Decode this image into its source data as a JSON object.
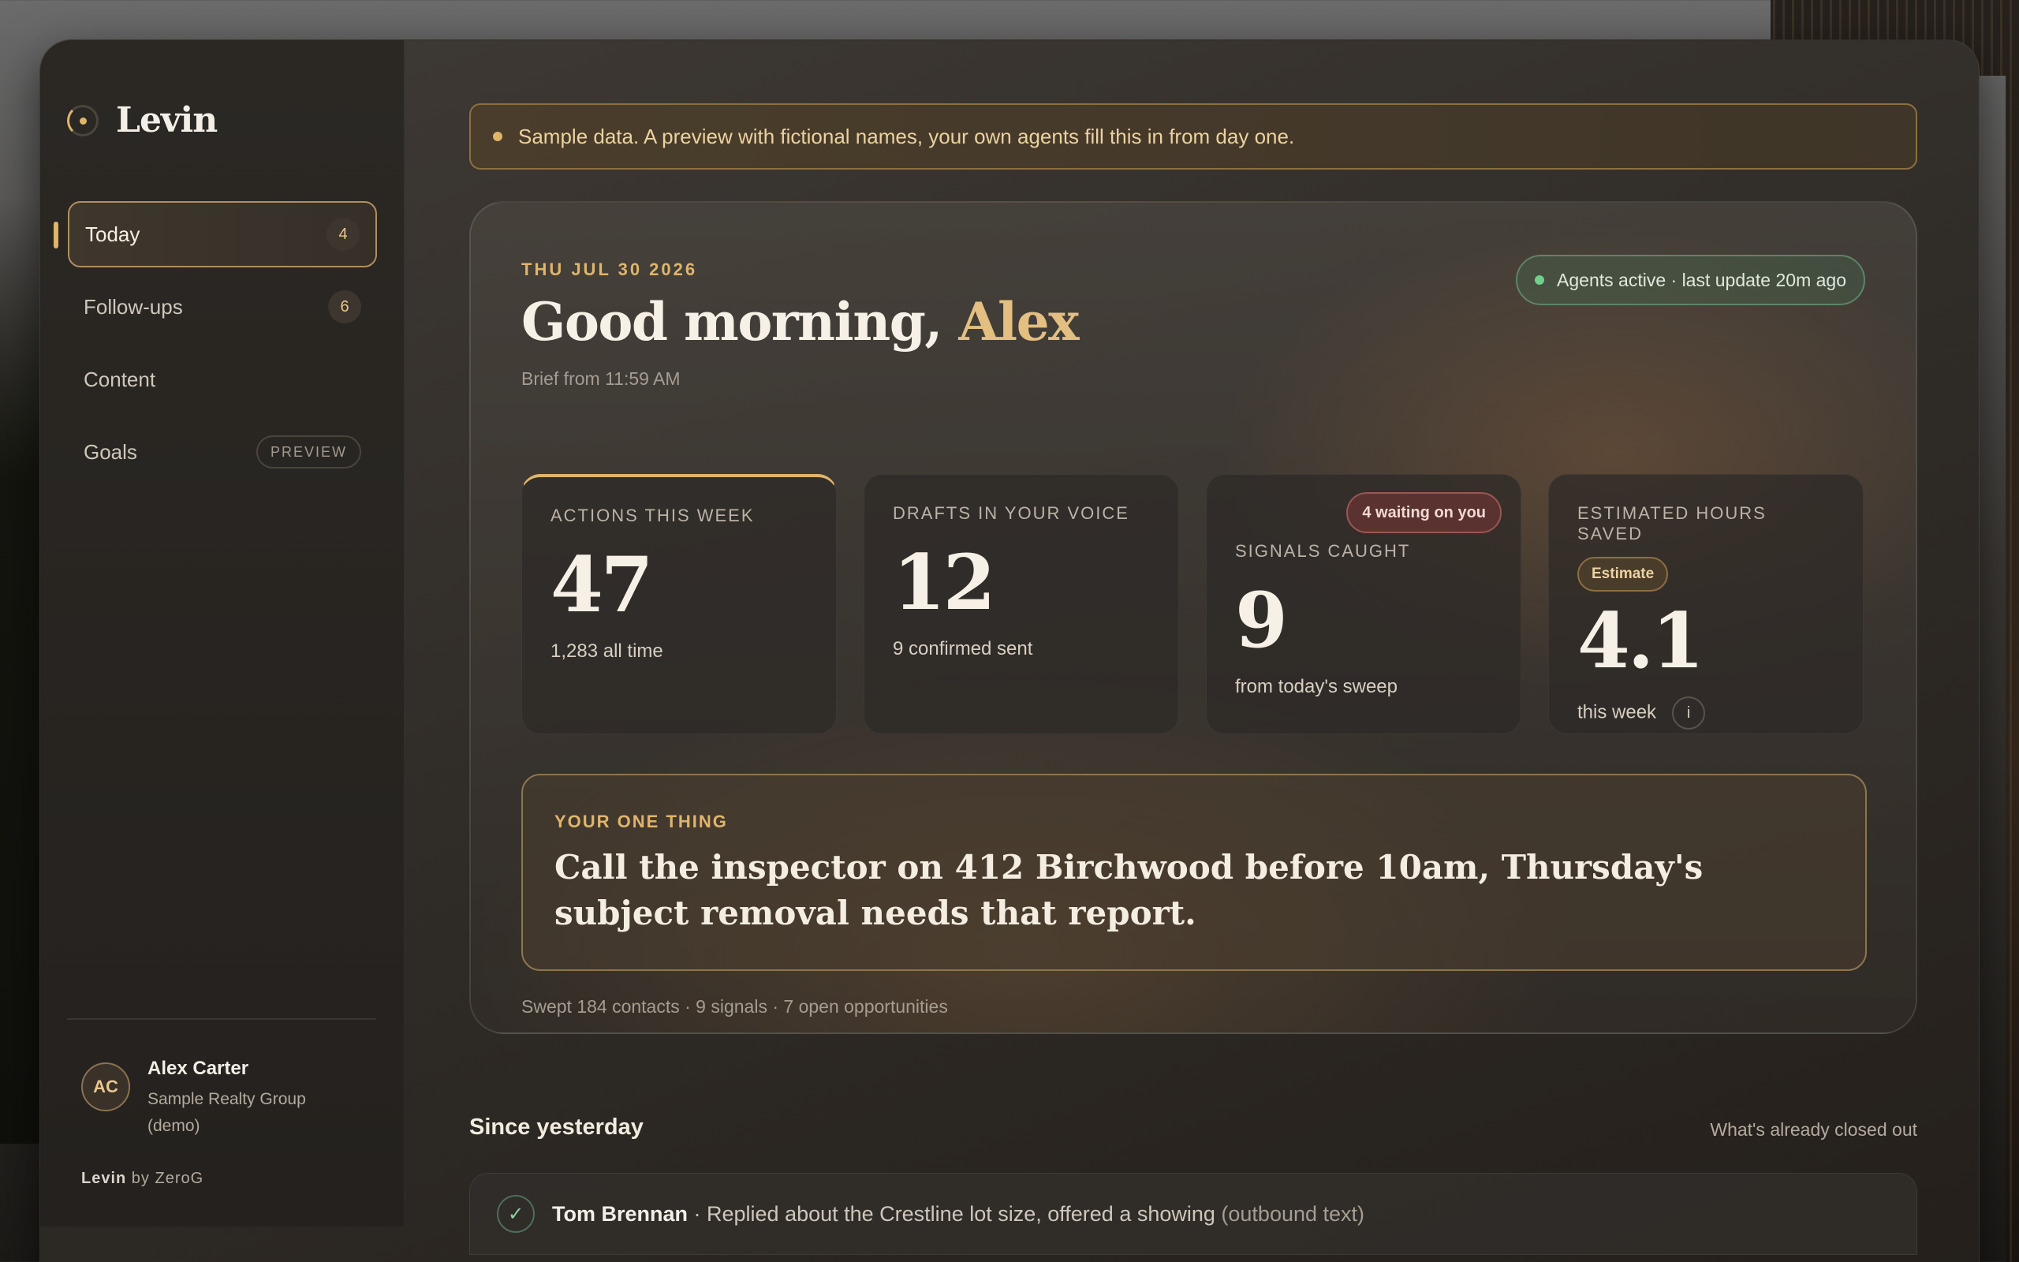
{
  "app": {
    "name": "Levin"
  },
  "nav": {
    "items": [
      {
        "label": "Today",
        "badge": "4"
      },
      {
        "label": "Follow-ups",
        "badge": "6"
      },
      {
        "label": "Content"
      },
      {
        "label": "Goals",
        "tag": "PREVIEW"
      }
    ]
  },
  "user": {
    "initials": "AC",
    "name": "Alex Carter",
    "org": "Sample Realty Group (demo)"
  },
  "byline": {
    "brand": "Levin",
    "by": " by ZeroG"
  },
  "notice": {
    "text": "Sample data. A preview with fictional names, your own agents fill this in from day one."
  },
  "hero": {
    "date": "THU JUL 30 2026",
    "greeting": "Good morning, ",
    "name": "Alex",
    "sub": "Brief from 11:59 AM",
    "status": "Agents active · last update 20m ago",
    "footer": "Swept 184 contacts · 9 signals · 7 open opportunities"
  },
  "stats": [
    {
      "label": "ACTIONS THIS WEEK",
      "value": "47",
      "note": "1,283 all time"
    },
    {
      "label": "DRAFTS IN YOUR VOICE",
      "value": "12",
      "note": "9 confirmed sent"
    },
    {
      "label": "SIGNALS CAUGHT",
      "value": "9",
      "note": "from today's sweep",
      "chip": "4 waiting on you"
    },
    {
      "label": "ESTIMATED HOURS SAVED",
      "value": "4.1",
      "note": "this week",
      "chip": "Estimate",
      "info": "i"
    }
  ],
  "one_thing": {
    "label": "YOUR ONE THING",
    "text": "Call the inspector on 412 Birchwood before 10am, Thursday's subject removal needs that report."
  },
  "since": {
    "title": "Since yesterday",
    "link": "What's already closed out",
    "rows": [
      {
        "name": "Tom Brennan",
        "text": " · Replied about the Crestline lot size, offered a showing ",
        "muted": "(outbound text)"
      }
    ]
  }
}
